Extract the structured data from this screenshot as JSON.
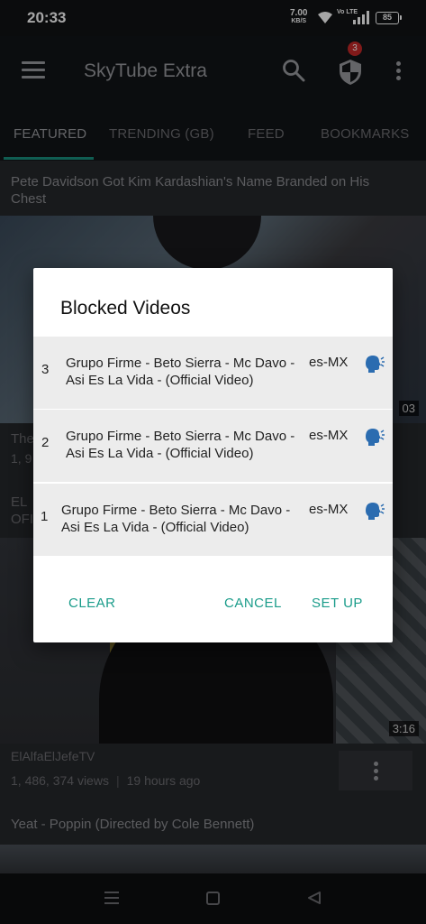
{
  "status_bar": {
    "time": "20:33",
    "net_speed": "7.00",
    "net_unit": "KB/S",
    "volte": "Vo LTE",
    "battery": "85"
  },
  "app_bar": {
    "title": "SkyTube Extra",
    "blocked_badge": "3"
  },
  "tabs": [
    {
      "label": "FEATURED",
      "active": true
    },
    {
      "label": "TRENDING (GB)",
      "active": false
    },
    {
      "label": "FEED",
      "active": false
    },
    {
      "label": "BOOKMARKS",
      "active": false
    }
  ],
  "feed": {
    "videos": [
      {
        "title": "Pete Davidson Got Kim Kardashian's Name Branded on His Chest",
        "duration_partial": "03",
        "title_partial": "The",
        "meta_partial": "1, 9"
      },
      {
        "title_partial": "EL",
        "title_partial_2": "OFI",
        "duration": "3:16",
        "channel": "ElAlfaElJefeTV",
        "views": "1, 486, 374 views",
        "age": "19 hours ago"
      },
      {
        "title": "Yeat - Poppin (Directed by Cole Bennett)"
      }
    ]
  },
  "dialog": {
    "title": "Blocked Videos",
    "rows": [
      {
        "index": "3",
        "title": "Grupo Firme - Beto Sierra - Mc Davo - Asi Es La Vida - (Official Video)",
        "lang": "es-MX",
        "icon": "speaking-head-icon"
      },
      {
        "index": "2",
        "title": "Grupo Firme - Beto Sierra - Mc Davo - Asi Es La Vida - (Official Video)",
        "lang": "es-MX",
        "icon": "speaking-head-icon"
      },
      {
        "index": "1",
        "title": "Grupo Firme - Beto Sierra - Mc Davo - Asi Es La Vida - (Official Video)",
        "lang": "es-MX",
        "icon": "speaking-head-icon"
      }
    ],
    "buttons": {
      "clear": "CLEAR",
      "cancel": "CANCEL",
      "setup": "SET UP"
    }
  },
  "colors": {
    "accent": "#1a9c8a",
    "badge": "#c62828",
    "toolbar": "#121417",
    "background": "#26282c"
  }
}
